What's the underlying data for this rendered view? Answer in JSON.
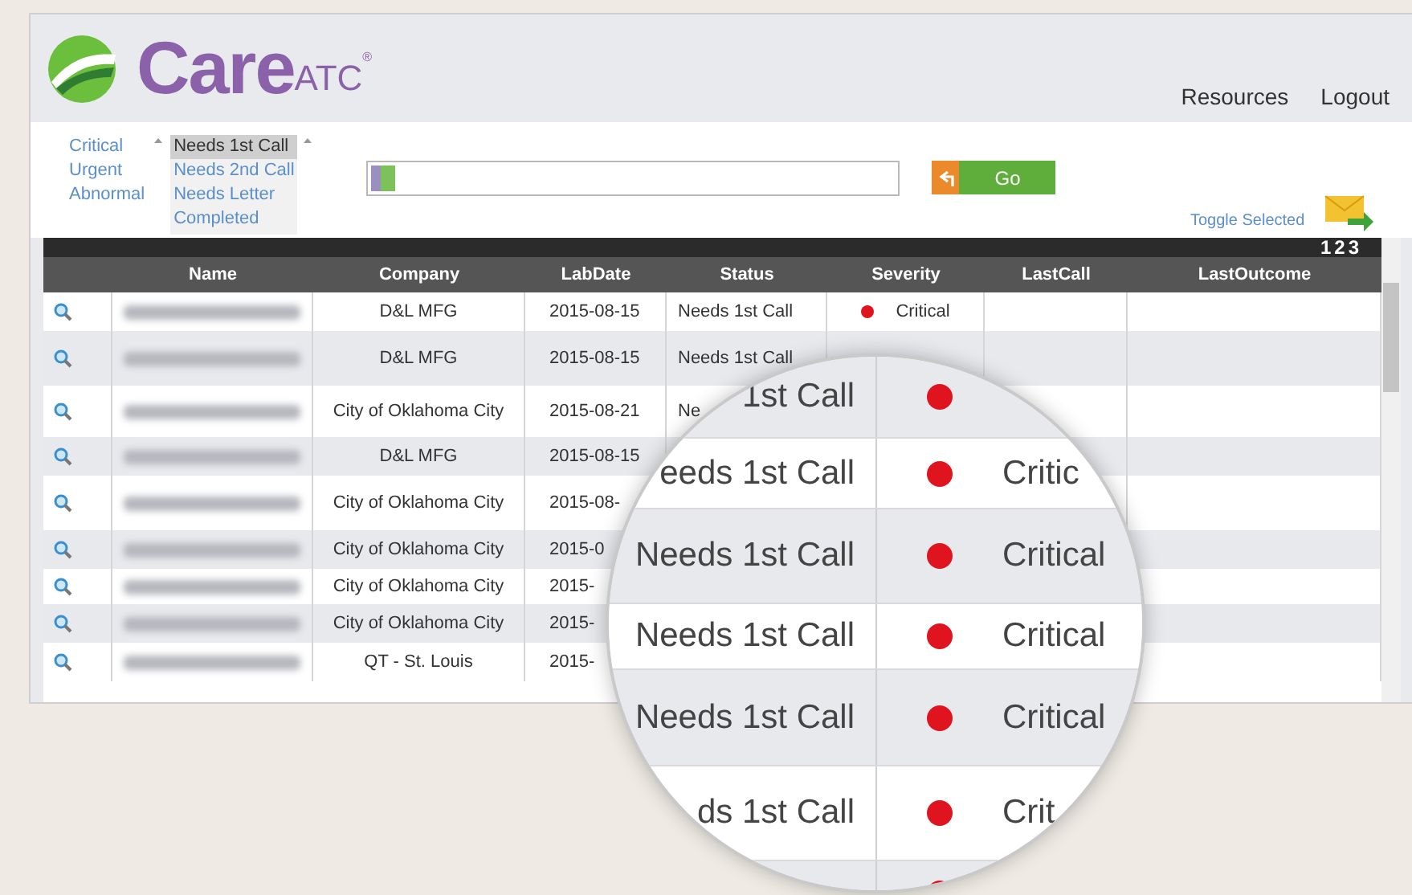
{
  "header": {
    "logo": {
      "brand": "Care",
      "suffix": "ATC",
      "mark": "®"
    },
    "nav": [
      "Resources",
      "Logout"
    ]
  },
  "filters": {
    "severity_list": [
      {
        "label": "Critical",
        "selected": false
      },
      {
        "label": "Urgent",
        "selected": false
      },
      {
        "label": "Abnormal",
        "selected": false
      }
    ],
    "status_list": [
      {
        "label": "Needs 1st Call",
        "selected": true
      },
      {
        "label": "Needs 2nd Call",
        "selected": false
      },
      {
        "label": "Needs Letter",
        "selected": false
      },
      {
        "label": "Completed",
        "selected": false
      }
    ]
  },
  "search": {
    "button": "Go"
  },
  "toggle": "Toggle Selected",
  "pagination": [
    "1",
    "2",
    "3"
  ],
  "table": {
    "columns": [
      "Name",
      "Company",
      "LabDate",
      "Status",
      "Severity",
      "LastCall",
      "LastOutcome"
    ],
    "rows": [
      {
        "company": "D&L MFG",
        "lab_date": "2015-08-15",
        "status": "Needs 1st Call",
        "severity": "Critical",
        "color": "#e0141e"
      },
      {
        "company": "D&L MFG",
        "lab_date": "2015-08-15",
        "status": "Needs 1st Call"
      },
      {
        "company": "City of Oklahoma City",
        "lab_date": "2015-08-21",
        "status": "Ne"
      },
      {
        "company": "D&L MFG",
        "lab_date": "2015-08-15"
      },
      {
        "company": "City of Oklahoma City",
        "lab_date": "2015-08-"
      },
      {
        "company": "City of Oklahoma City",
        "lab_date": "2015-0"
      },
      {
        "company": "City of Oklahoma City",
        "lab_date": "2015-"
      },
      {
        "company": "City of Oklahoma City",
        "lab_date": "2015-"
      },
      {
        "company": "QT - St. Louis",
        "lab_date": "2015-"
      }
    ]
  },
  "magnifier": {
    "rows": [
      {
        "status": "1st Call",
        "color": "#e0141e"
      },
      {
        "status": "eeds 1st Call",
        "severity": "Critic",
        "color": "#e0141e"
      },
      {
        "status": "Needs 1st Call",
        "severity": "Critical",
        "color": "#e0141e"
      },
      {
        "status": "Needs 1st Call",
        "severity": "Critical",
        "color": "#e0141e"
      },
      {
        "status": "Needs 1st Call",
        "severity": "Critical",
        "color": "#e0141e"
      },
      {
        "status": "ds 1st Call",
        "severity": "Crit",
        "color": "#e0141e"
      },
      {
        "color": "#e0141e"
      }
    ]
  }
}
